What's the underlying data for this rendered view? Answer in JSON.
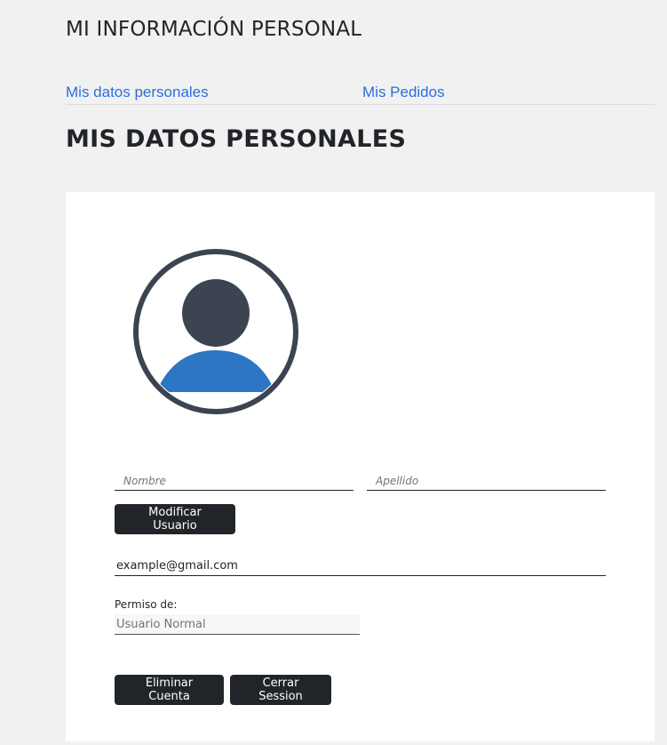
{
  "header": {
    "section_title": "MI INFORMACIÓN PERSONAL"
  },
  "tabs": [
    {
      "label": "Mis datos personales"
    },
    {
      "label": "Mis Pedidos"
    }
  ],
  "main": {
    "page_title": "MIS DATOS PERSONALES"
  },
  "avatar": {
    "icon": "user-avatar-icon",
    "ring_color": "#3b4450",
    "head_color": "#3b4450",
    "body_color": "#2c76c4"
  },
  "form": {
    "nombre": {
      "placeholder": "Nombre",
      "value": ""
    },
    "apellido": {
      "placeholder": "Apellido",
      "value": ""
    },
    "modificar_label": "Modificar Usuario",
    "email": {
      "value": "example@gmail.com"
    },
    "permiso_label": "Permiso de:",
    "permiso_value": "Usuario Normal",
    "eliminar_label": "Eliminar Cuenta",
    "cerrar_label": "Cerrar Session"
  },
  "colors": {
    "link": "#2b6ee0",
    "button_bg": "#212529",
    "page_bg": "#f1f1f1"
  }
}
